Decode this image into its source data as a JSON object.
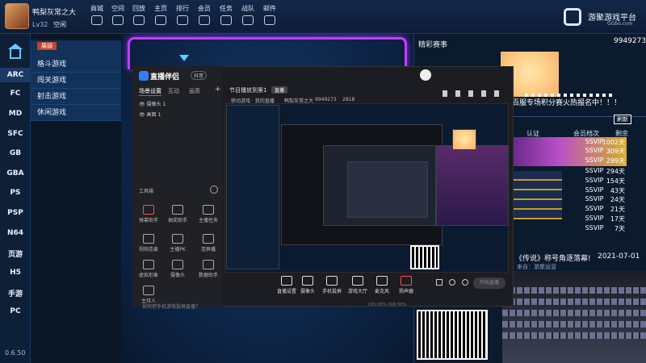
{
  "topbar": {
    "username": "鸭梨灰常之大",
    "level": "Lv32",
    "status": "空闲",
    "nav": [
      "商城",
      "空间",
      "回放",
      "主页",
      "排行",
      "会员",
      "任务",
      "战队",
      "邮件"
    ],
    "logo_text": "游聚游戏平台",
    "logo_sub": "GGbo.com"
  },
  "sidebar": {
    "items": [
      "ARC",
      "FC",
      "MD",
      "SFC",
      "GB",
      "GBA",
      "PS",
      "PSP",
      "N64",
      "页游",
      "H5",
      "手游",
      "PC"
    ],
    "version": "0.6.50"
  },
  "submenu": {
    "header": "展翅",
    "items": [
      "格斗游戏",
      "闯关游戏",
      "射击游戏",
      "休闲游戏"
    ]
  },
  "right_panel": {
    "title": "精彩赛事",
    "score": "9949273",
    "banner": "百服专场积分赛火热报名中！！！",
    "columns": [
      "认证",
      "会员档次",
      "剩余"
    ],
    "ranks": [
      {
        "vip": "SSVIP",
        "days": "1002天"
      },
      {
        "vip": "SSVIP",
        "days": "309天"
      },
      {
        "vip": "SSVIP",
        "days": "299天"
      },
      {
        "vip": "SSVIP",
        "days": "294天"
      },
      {
        "vip": "SSVIP",
        "days": "154天"
      },
      {
        "vip": "SSVIP",
        "days": "43天"
      },
      {
        "vip": "SSVIP",
        "days": "24天"
      },
      {
        "vip": "SSVIP",
        "days": "21天"
      },
      {
        "vip": "SSVIP",
        "days": "17天"
      },
      {
        "vip": "SSVIP",
        "days": "7天"
      }
    ],
    "news": "《传说》称号角逐落幕!",
    "news_date": "2021-07-01",
    "news_from": "来自：游聚运营"
  },
  "app": {
    "title": "直播伴侣",
    "badge": "抖音",
    "tabs": [
      "场景设置",
      "互动",
      "画质"
    ],
    "scenes": [
      "摄像头 1",
      "画面 1"
    ],
    "toolbox_label": "工具箱",
    "tools": [
      "弹幕助手",
      "抽奖助手",
      "主播任务",
      "视频连麦",
      "主播PK",
      "连屏播",
      "虚拟形象",
      "摄像头",
      "数据助手",
      "主持人"
    ],
    "tip": "如何把手机游戏投屏直播？",
    "room": "节目播放到第1",
    "live_btn": "直播",
    "sub": "移动游戏 · 我的直播",
    "user": "鸭梨灰常之大",
    "num": "9949273",
    "cnt": "2818",
    "bottom": [
      "直播设置",
      "摄像头",
      "手机投屏",
      "游戏大厅",
      "麦克风",
      "扬声器"
    ],
    "start": "开始直播",
    "status": "CPU:35% 内存:50%"
  }
}
